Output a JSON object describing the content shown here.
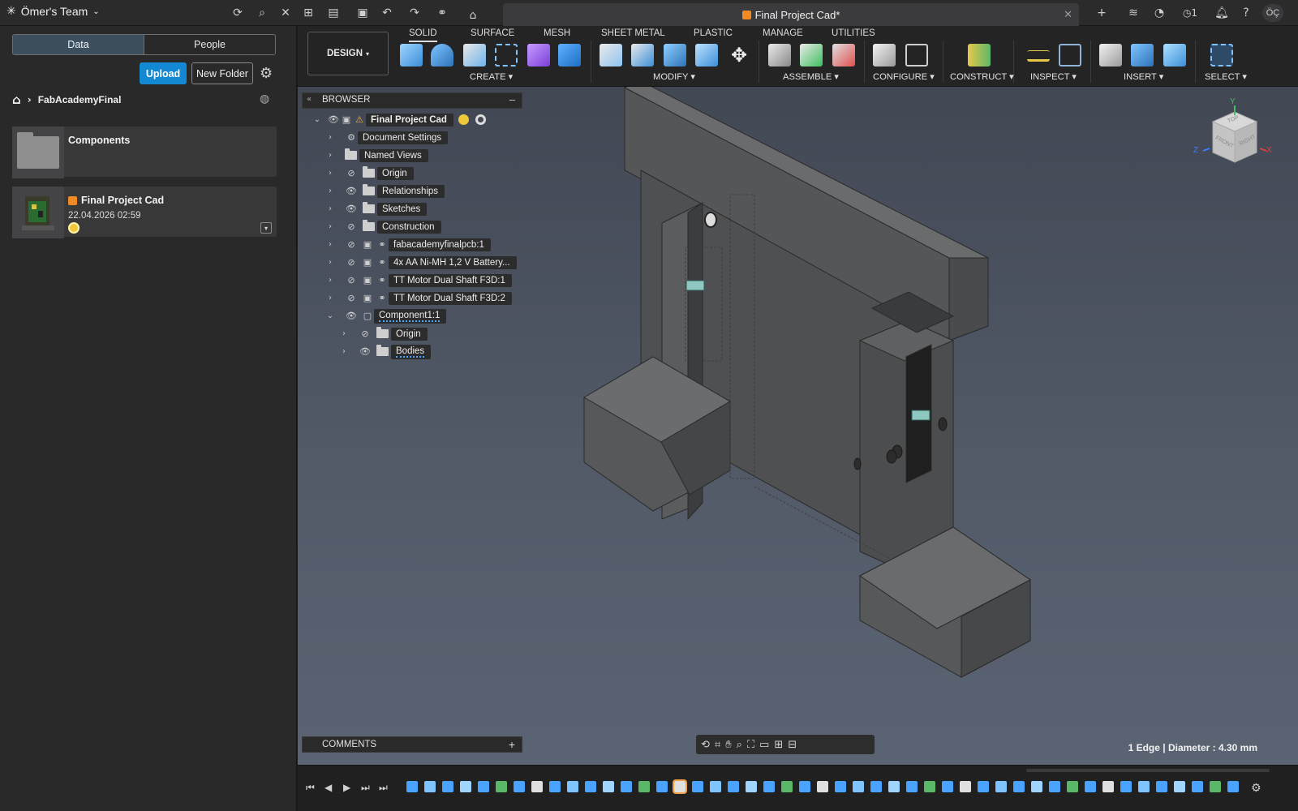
{
  "topbar": {
    "team": "Ömer's Team",
    "doc_tab_title": "Final Project Cad*",
    "jobs_count": "1",
    "user_initials": "ÖÇ"
  },
  "left_panel": {
    "tabs": [
      "Data",
      "People"
    ],
    "upload_label": "Upload",
    "new_folder_label": "New Folder",
    "breadcrumb": "FabAcademyFinal",
    "items": [
      {
        "title": "Components",
        "subtitle": ""
      },
      {
        "title": "Final Project Cad",
        "subtitle": "22.04.2026 02:59"
      }
    ]
  },
  "toolbar": {
    "workspace": "DESIGN",
    "tabs": [
      "SOLID",
      "SURFACE",
      "MESH",
      "SHEET METAL",
      "PLASTIC",
      "MANAGE",
      "UTILITIES"
    ],
    "groups": [
      "CREATE",
      "MODIFY",
      "ASSEMBLE",
      "CONFIGURE",
      "CONSTRUCT",
      "INSPECT",
      "INSERT",
      "SELECT"
    ]
  },
  "browser": {
    "title": "BROWSER",
    "root": "Final Project Cad",
    "nodes": [
      "Document Settings",
      "Named Views",
      "Origin",
      "Relationships",
      "Sketches",
      "Construction",
      "fabacademyfinalpcb:1",
      "4x AA Ni-MH 1,2 V Battery...",
      "TT Motor Dual Shaft F3D:1",
      "TT Motor Dual Shaft F3D:2",
      "Component1:1",
      "Origin",
      "Bodies"
    ]
  },
  "comments": {
    "title": "COMMENTS"
  },
  "viewcube": {
    "top": "TOP",
    "front": "FRONT",
    "right": "RIGHT",
    "axis_y": "Y",
    "axis_z": "Z",
    "axis_x": "X"
  },
  "status": "1 Edge | Diameter : 4.30 mm",
  "colors": {
    "accent": "#1389d4",
    "selection": "#4aa3ff",
    "warning": "#f0b429",
    "doc_icon": "#f08a24"
  }
}
